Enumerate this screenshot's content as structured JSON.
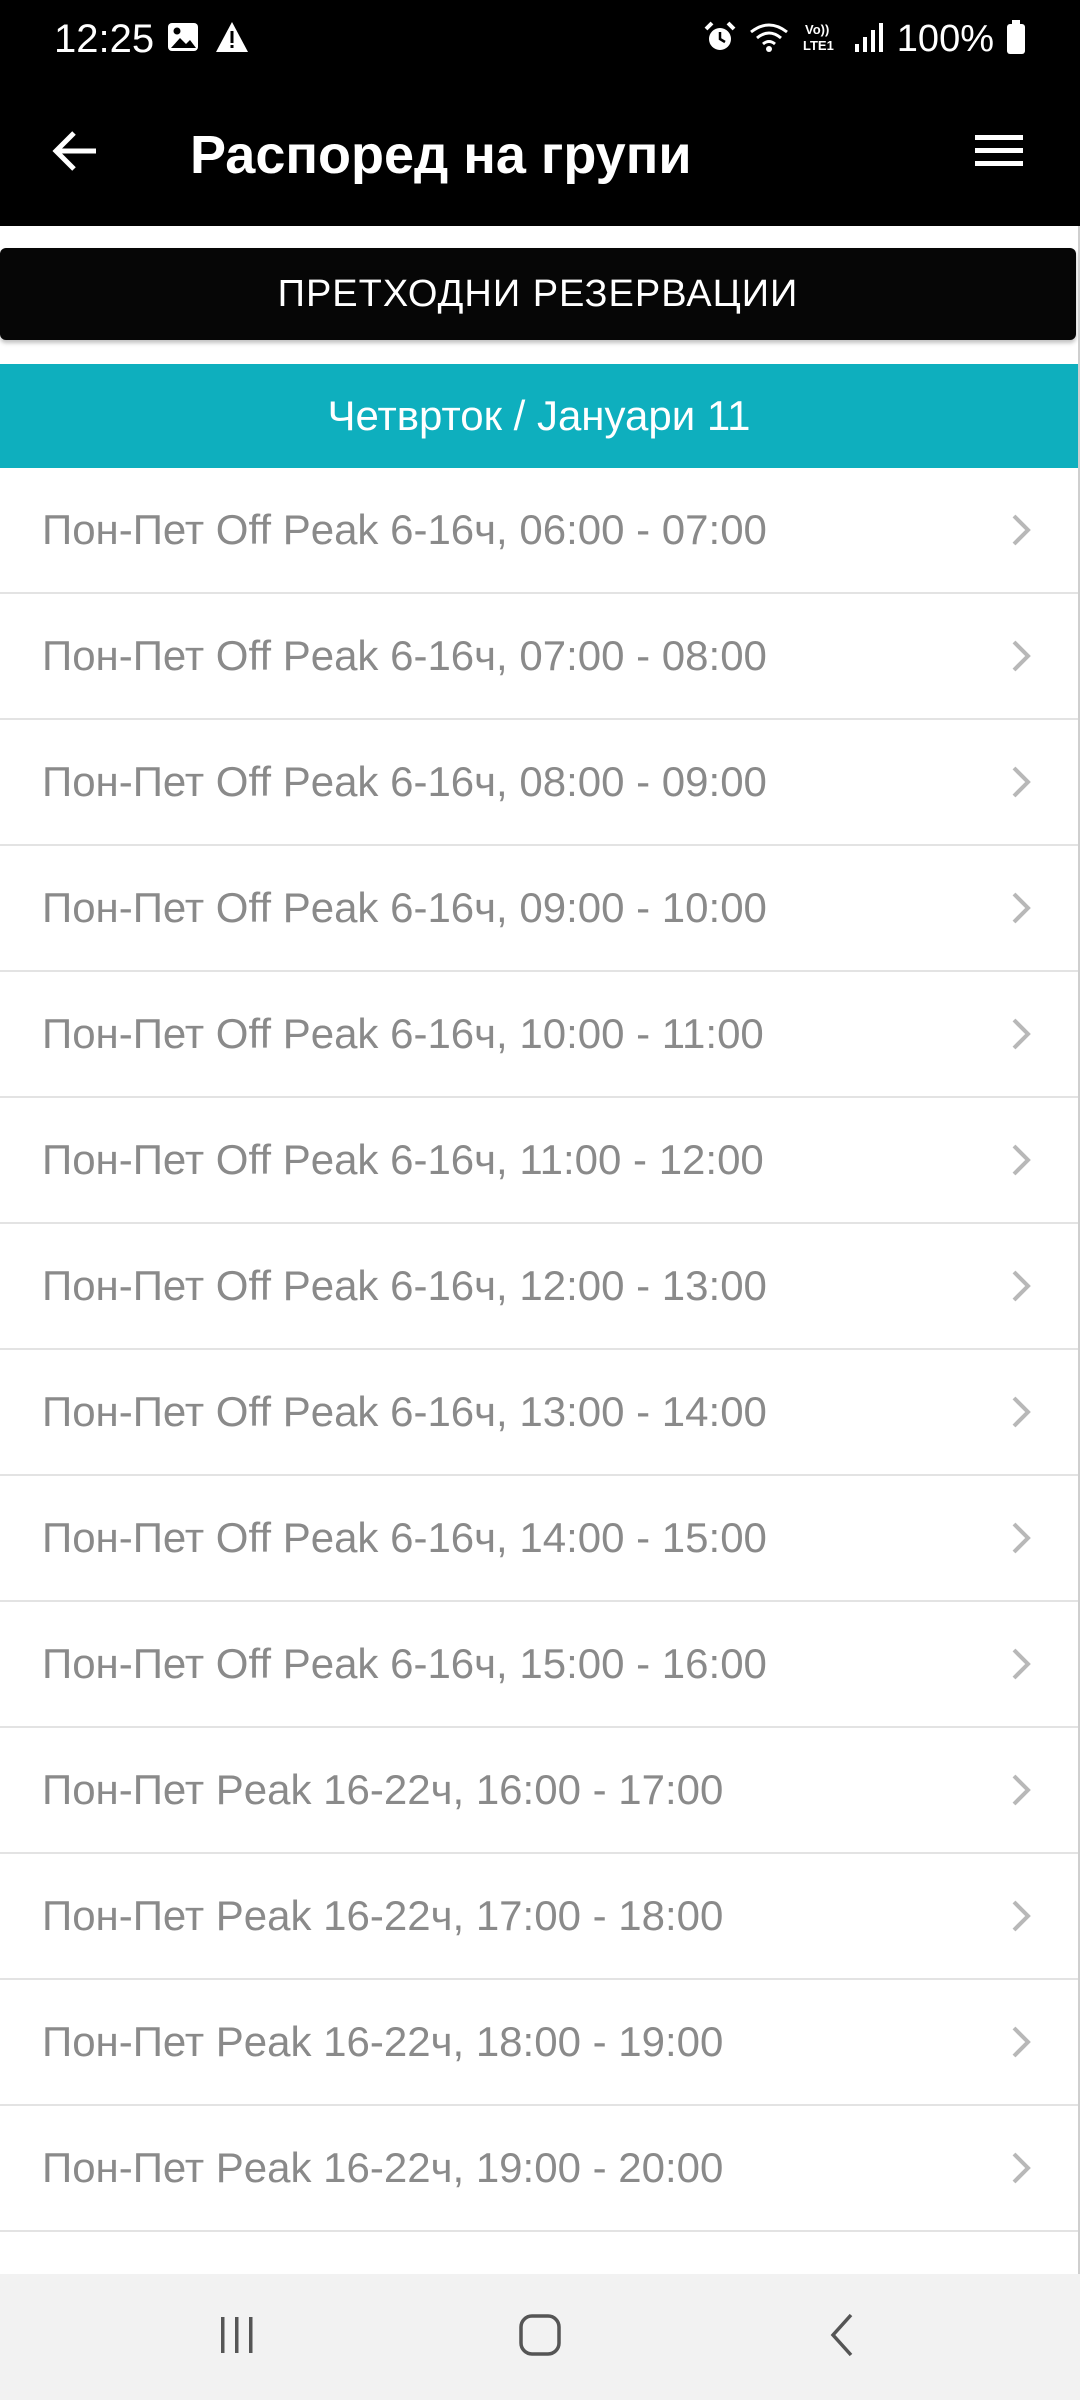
{
  "status_bar": {
    "time": "12:25",
    "left_icons": [
      "image-icon",
      "warning-icon"
    ],
    "right_icons": [
      "alarm-icon",
      "wifi-calling-icon",
      "volte-icon",
      "signal-icon"
    ],
    "battery": "100%"
  },
  "app_bar": {
    "title": "Распоред на групи",
    "back_icon": "arrow-left-icon",
    "menu_icon": "hamburger-menu-icon"
  },
  "previous_button": {
    "label": "ПРЕТХОДНИ РЕЗЕРВАЦИИ"
  },
  "date_header": {
    "label": "Четврток / Јануари 11",
    "color": "#0eafbe"
  },
  "schedule": [
    {
      "label": "Пон-Пет Off Peak 6-16ч, 06:00 - 07:00"
    },
    {
      "label": "Пон-Пет Off Peak 6-16ч, 07:00 - 08:00"
    },
    {
      "label": "Пон-Пет Off Peak 6-16ч, 08:00 - 09:00"
    },
    {
      "label": "Пон-Пет Off Peak 6-16ч, 09:00 - 10:00"
    },
    {
      "label": "Пон-Пет Off Peak 6-16ч, 10:00 - 11:00"
    },
    {
      "label": "Пон-Пет Off Peak 6-16ч, 11:00 - 12:00"
    },
    {
      "label": "Пон-Пет Off Peak 6-16ч, 12:00 - 13:00"
    },
    {
      "label": "Пон-Пет Off Peak 6-16ч, 13:00 - 14:00"
    },
    {
      "label": "Пон-Пет Off Peak 6-16ч, 14:00 - 15:00"
    },
    {
      "label": "Пон-Пет Off Peak 6-16ч, 15:00 - 16:00"
    },
    {
      "label": "Пон-Пет Peak 16-22ч, 16:00 - 17:00"
    },
    {
      "label": "Пон-Пет Peak 16-22ч, 17:00 - 18:00"
    },
    {
      "label": "Пон-Пет Peak 16-22ч, 18:00 - 19:00"
    },
    {
      "label": "Пон-Пет Peak 16-22ч, 19:00 - 20:00"
    }
  ],
  "nav_bar": {
    "recents_icon": "recents-icon",
    "home_icon": "home-icon",
    "back_icon": "back-chevron-icon"
  }
}
